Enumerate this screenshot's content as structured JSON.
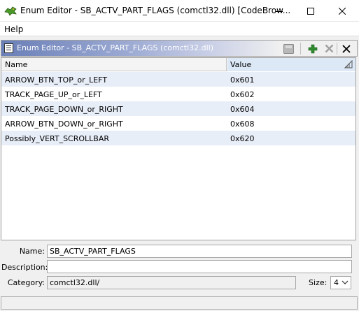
{
  "window": {
    "title": "Enum Editor - SB_ACTV_PART_FLAGS (comctl32.dll) [CodeBrow...",
    "controls": [
      "minimize",
      "maximize",
      "close"
    ]
  },
  "menu": {
    "help": "Help"
  },
  "panel": {
    "title": "Enum Editor - SB_ACTV_PART_FLAGS (comctl32.dll)",
    "tools": [
      "save-icon",
      "add-icon",
      "delete-icon",
      "close-icon"
    ]
  },
  "table": {
    "columns": {
      "name": "Name",
      "value": "Value"
    },
    "rows": [
      {
        "name": "ARROW_BTN_TOP_or_LEFT",
        "value": "0x601"
      },
      {
        "name": "TRACK_PAGE_UP_or_LEFT",
        "value": "0x602"
      },
      {
        "name": "TRACK_PAGE_DOWN_or_RIGHT",
        "value": "0x604"
      },
      {
        "name": "ARROW_BTN_DOWN_or_RIGHT",
        "value": "0x608"
      },
      {
        "name": "Possibly_VERT_SCROLLBAR",
        "value": "0x620"
      }
    ]
  },
  "form": {
    "name_label": "Name:",
    "name_value": "SB_ACTV_PART_FLAGS",
    "description_label": "Description:",
    "description_value": "",
    "category_label": "Category:",
    "category_value": "comctl32.dll/",
    "size_label": "Size:",
    "size_value": "4"
  },
  "colors": {
    "panel_title_gradient_start": "#6a7fb8",
    "row_alt": "#e8eef8",
    "add_icon": "#2e8b2e"
  }
}
